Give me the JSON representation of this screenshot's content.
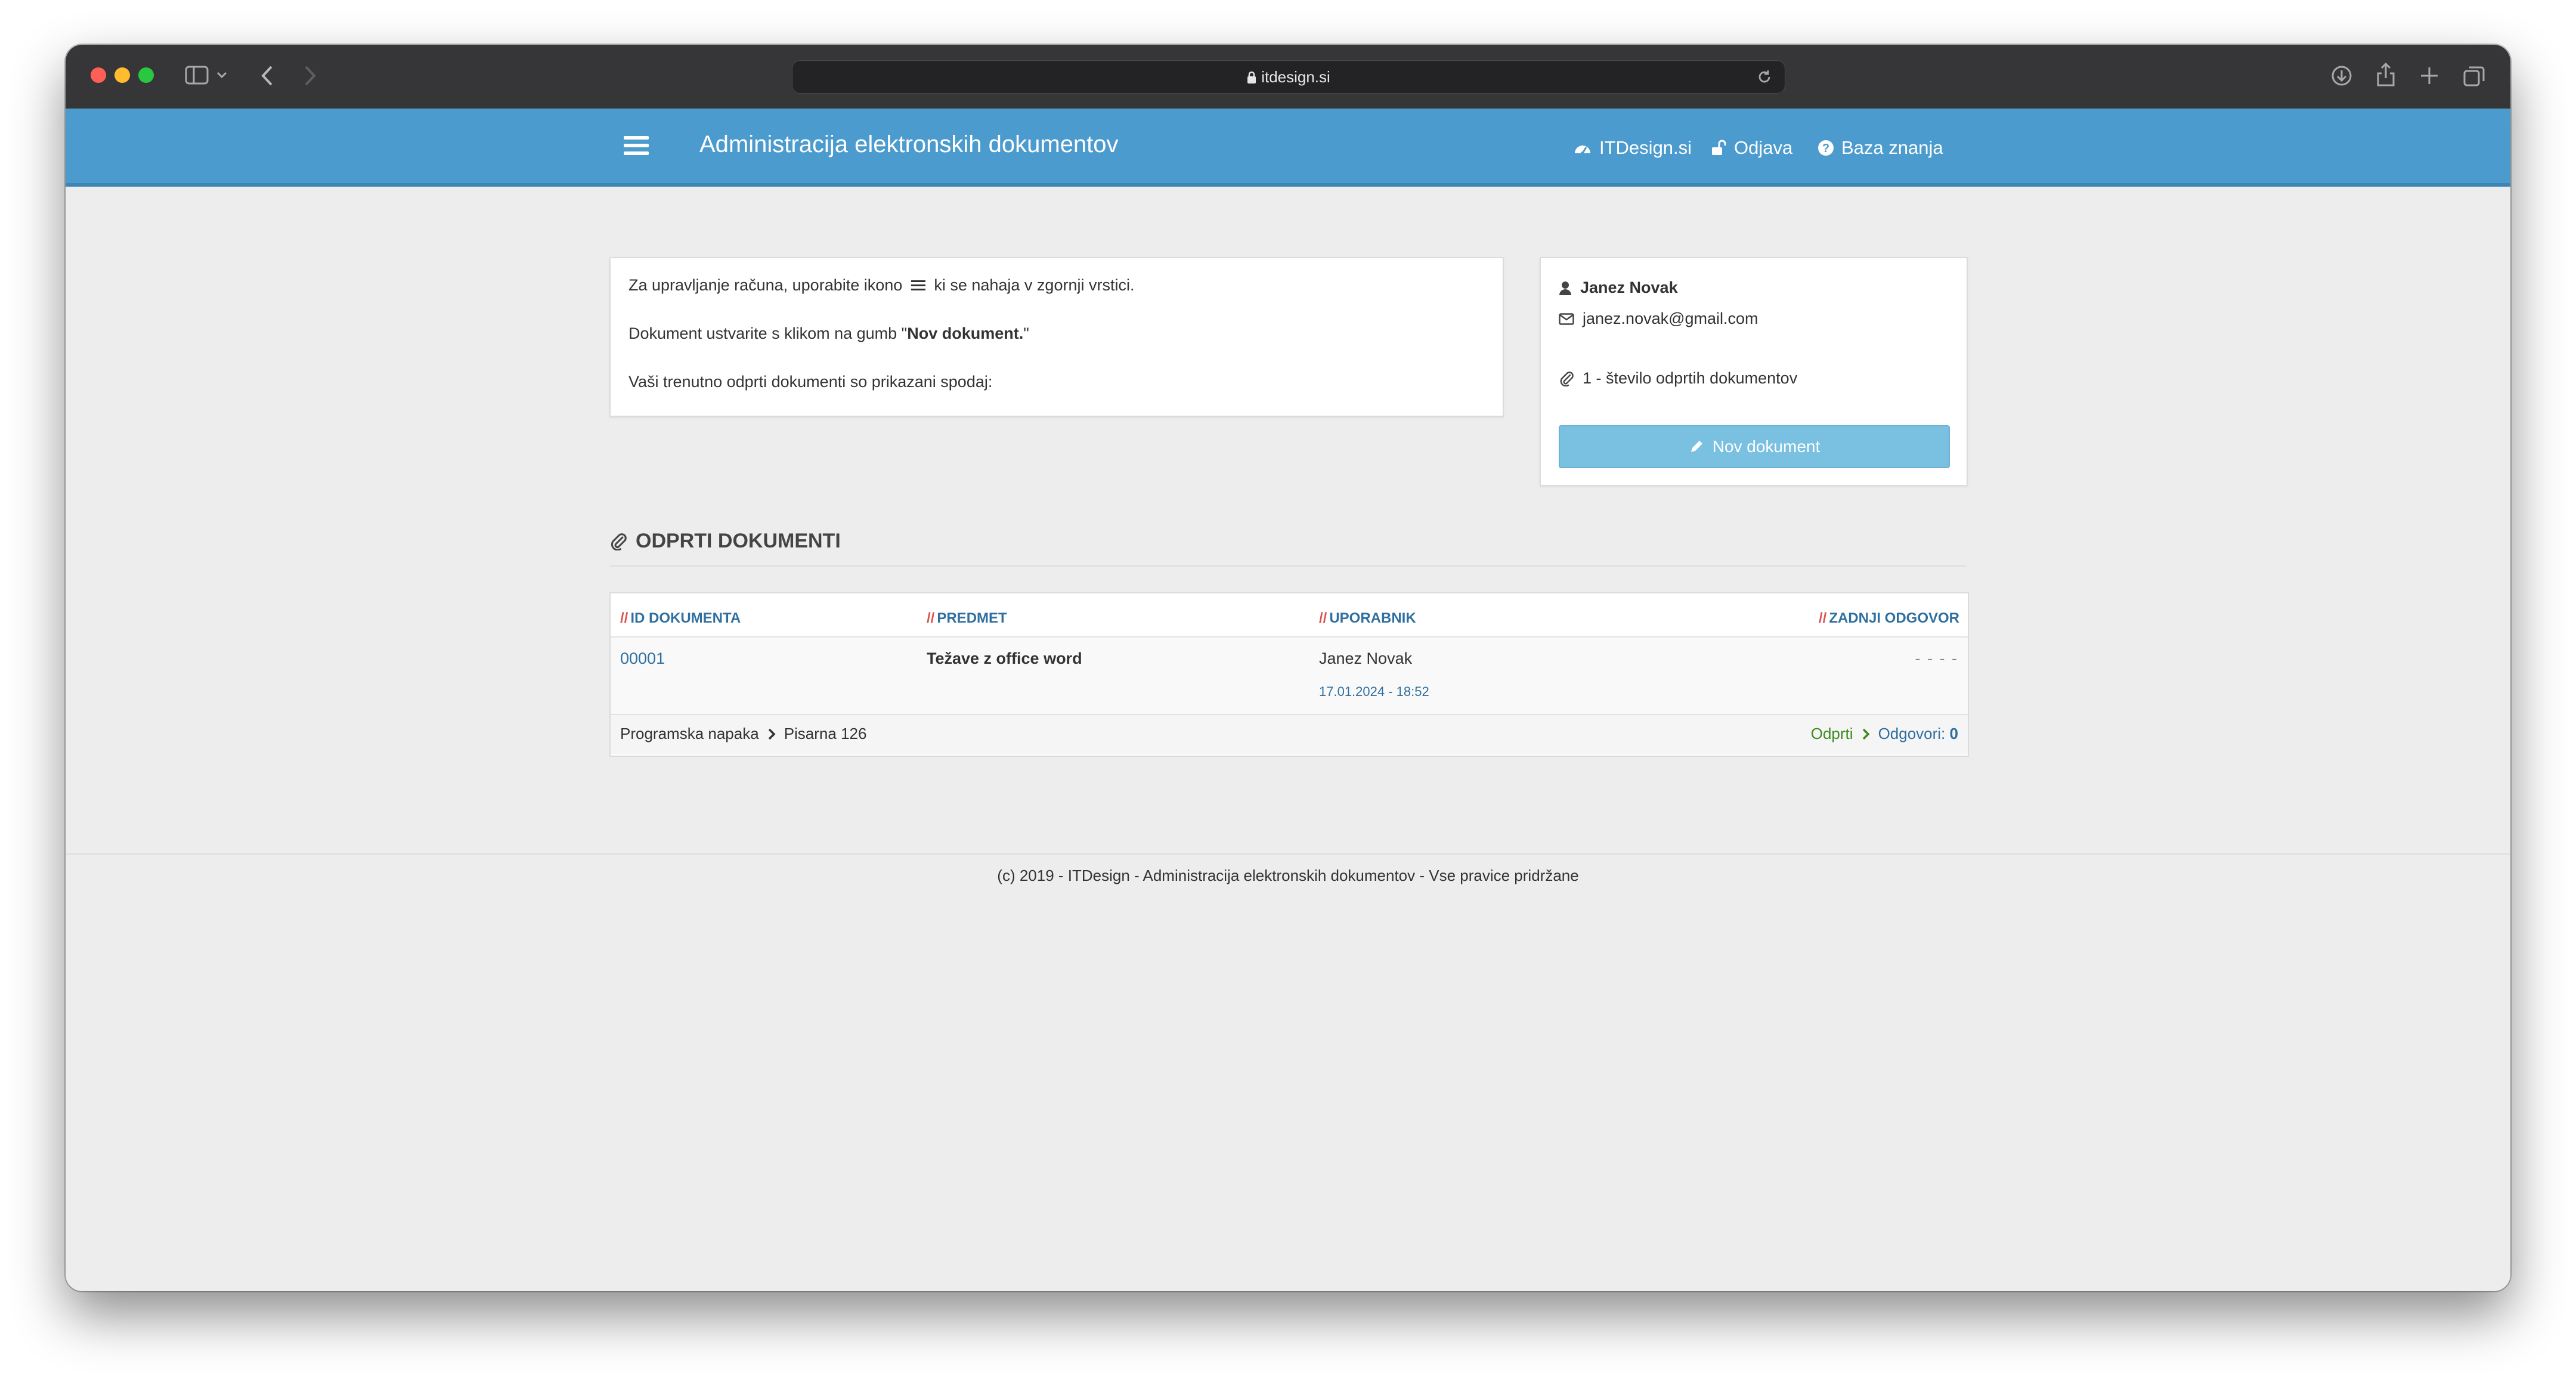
{
  "browser": {
    "url": "itdesign.si"
  },
  "navbar": {
    "title": "Administracija elektronskih dokumentov",
    "links": {
      "itdesign": "ITDesign.si",
      "logout": "Odjava",
      "kb": "Baza znanja"
    }
  },
  "info": {
    "line1_pre": "Za upravljanje računa, uporabite ikono",
    "line1_post": "ki se nahaja v zgornji vrstici.",
    "line2_pre": "Dokument ustvarite s klikom na gumb \"",
    "line2_bold": "Nov dokument.",
    "line2_post": "\"",
    "line3": "Vaši trenutno odprti dokumenti so prikazani spodaj:"
  },
  "user": {
    "name": "Janez Novak",
    "email": "janez.novak@gmail.com",
    "open_count": "1 - število odprtih dokumentov",
    "new_button": "Nov dokument"
  },
  "documents": {
    "section_title": "ODPRTI DOKUMENTI",
    "headers": {
      "id": "ID DOKUMENTA",
      "subject": "PREDMET",
      "user": "UPORABNIK",
      "last_reply": "ZADNJI ODGOVOR"
    },
    "rows": [
      {
        "id": "00001",
        "subject": "Težave z office word",
        "user": "Janez Novak",
        "date": "17.01.2024 - 18:52",
        "last_reply": "- - - -",
        "category": "Programska napaka",
        "location": "Pisarna 126",
        "status": "Odprti",
        "replies_label": "Odgovori:",
        "replies_count": "0"
      }
    ]
  },
  "footer": {
    "text": "(c) 2019 - ITDesign - Administracija elektronskih dokumentov - Vse pravice pridržane"
  },
  "colors": {
    "navbar": "#4b9bce",
    "button": "#7ac0e0",
    "link": "#2f6f9f",
    "status_green": "#3c8a1e",
    "slash_red": "#d9534f"
  }
}
